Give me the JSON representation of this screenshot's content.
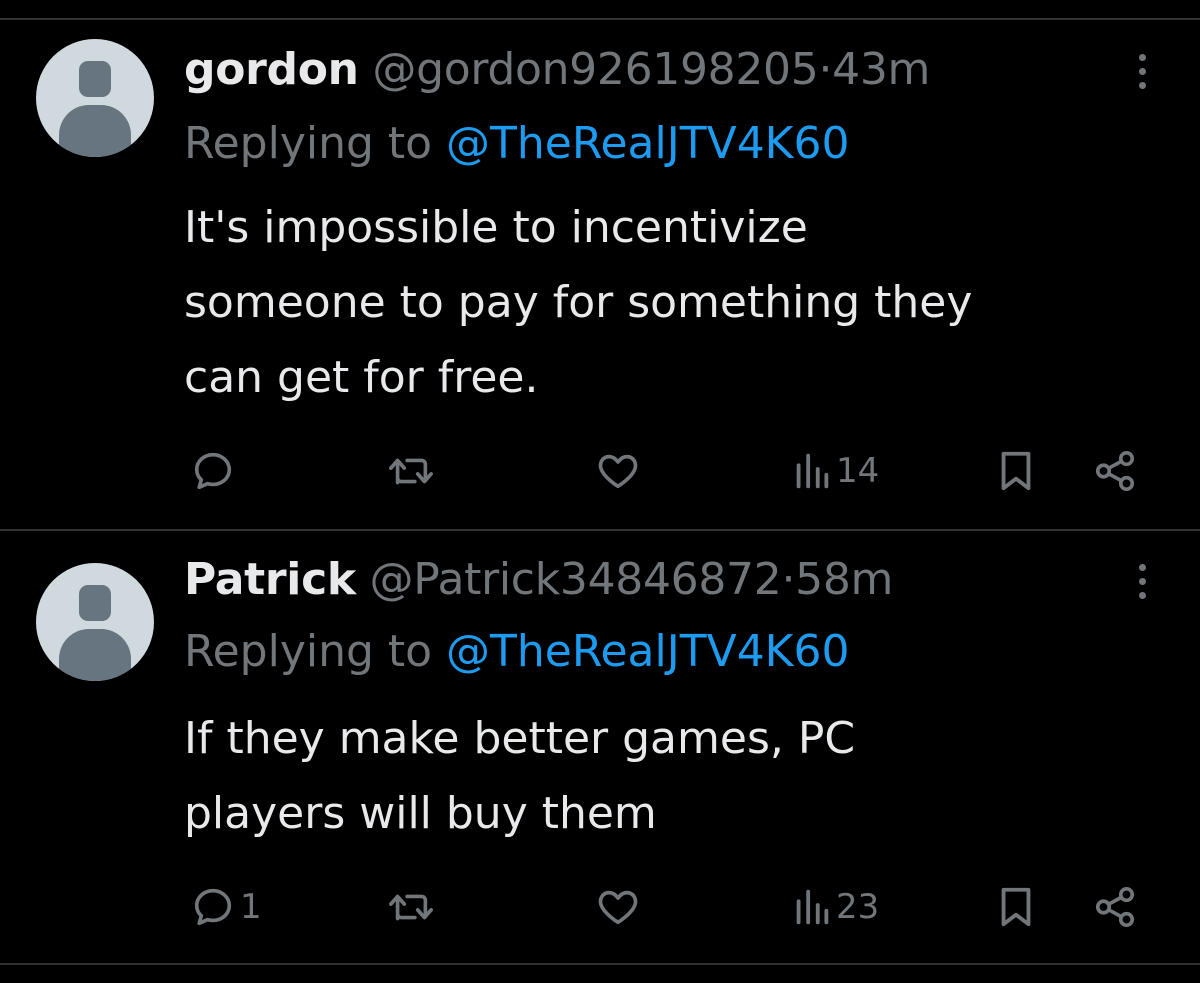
{
  "tweets": [
    {
      "display_name": "gordon",
      "handle": "@gordon926198205",
      "separator": "·",
      "time": "43m",
      "replying_prefix": "Replying to ",
      "replying_to": "@TheRealJTV4K60",
      "text_lines": [
        "It's impossible to incentivize",
        "someone to pay for something they",
        "can get for free."
      ],
      "actions": {
        "reply_icon": "reply-icon",
        "reply_count": "",
        "retweet_icon": "retweet-icon",
        "like_icon": "heart-icon",
        "views_icon": "views-icon",
        "views_count": "14",
        "bookmark_icon": "bookmark-icon",
        "share_icon": "share-icon"
      }
    },
    {
      "display_name": "Patrick",
      "handle": "@Patrick34846872",
      "separator": "·",
      "time": "58m",
      "replying_prefix": "Replying to ",
      "replying_to": "@TheRealJTV4K60",
      "text_lines": [
        "If they make better games, PC",
        "players will buy them"
      ],
      "actions": {
        "reply_icon": "reply-icon",
        "reply_count": "1",
        "retweet_icon": "retweet-icon",
        "like_icon": "heart-icon",
        "views_icon": "views-icon",
        "views_count": "23",
        "bookmark_icon": "bookmark-icon",
        "share_icon": "share-icon"
      }
    }
  ],
  "colors": {
    "background": "#000000",
    "primary_text": "#e7e9ea",
    "secondary_text": "#71767b",
    "link": "#1d9bf0",
    "divider": "#2f3336",
    "avatar_bg": "#cfd9de",
    "avatar_fg": "#66757f"
  }
}
